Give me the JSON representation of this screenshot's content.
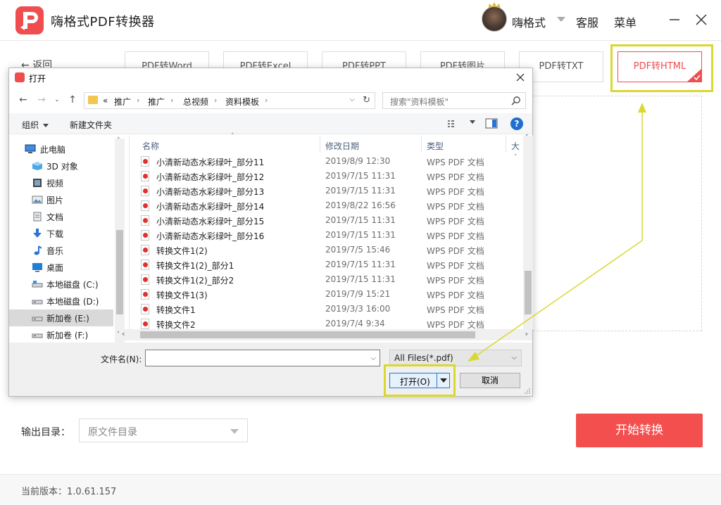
{
  "app": {
    "title": "嗨格式PDF转换器",
    "user_name": "嗨格式",
    "service": "客服",
    "menu": "菜单",
    "back": "返回",
    "version": "当前版本：1.0.61.157"
  },
  "tabs": [
    {
      "label": "PDF转Word"
    },
    {
      "label": "PDF转Excel"
    },
    {
      "label": "PDF转PPT"
    },
    {
      "label": "PDF转图片"
    },
    {
      "label": "PDF转TXT"
    },
    {
      "label": "PDF转HTML",
      "active": true
    }
  ],
  "output": {
    "label": "输出目录：",
    "value": "原文件目录"
  },
  "start_button": "开始转换",
  "colors": {
    "accent": "#f04e4e",
    "annotation": "#d9d830",
    "dialog_primary": "#2a74d8"
  },
  "dialog": {
    "title": "打开",
    "path": [
      "«",
      "推广",
      "推广",
      "总视频",
      "资料模板"
    ],
    "search_placeholder": "搜索\"资料模板\"",
    "organize": "组织",
    "new_folder": "新建文件夹",
    "help": "?",
    "nav_items": [
      {
        "label": "此电脑",
        "icon": "computer-icon"
      },
      {
        "label": "3D 对象",
        "icon": "cube-icon"
      },
      {
        "label": "视频",
        "icon": "video-icon"
      },
      {
        "label": "图片",
        "icon": "picture-icon"
      },
      {
        "label": "文档",
        "icon": "document-icon"
      },
      {
        "label": "下载",
        "icon": "download-icon"
      },
      {
        "label": "音乐",
        "icon": "music-icon"
      },
      {
        "label": "桌面",
        "icon": "desktop-icon"
      },
      {
        "label": "本地磁盘 (C:)",
        "icon": "drive-icon"
      },
      {
        "label": "本地磁盘 (D:)",
        "icon": "drive-icon"
      },
      {
        "label": "新加卷 (E:)",
        "icon": "drive-icon",
        "selected": true
      },
      {
        "label": "新加卷 (F:)",
        "icon": "drive-icon"
      }
    ],
    "columns": [
      "名称",
      "修改日期",
      "类型",
      "大小"
    ],
    "files": [
      {
        "name": "小清新动态水彩绿叶_部分11",
        "date": "2019/8/9 12:30",
        "type": "WPS PDF 文档"
      },
      {
        "name": "小清新动态水彩绿叶_部分12",
        "date": "2019/7/15 11:31",
        "type": "WPS PDF 文档"
      },
      {
        "name": "小清新动态水彩绿叶_部分13",
        "date": "2019/7/15 11:31",
        "type": "WPS PDF 文档"
      },
      {
        "name": "小清新动态水彩绿叶_部分14",
        "date": "2019/8/22 16:56",
        "type": "WPS PDF 文档"
      },
      {
        "name": "小清新动态水彩绿叶_部分15",
        "date": "2019/7/15 11:31",
        "type": "WPS PDF 文档"
      },
      {
        "name": "小清新动态水彩绿叶_部分16",
        "date": "2019/7/15 11:31",
        "type": "WPS PDF 文档"
      },
      {
        "name": "转换文件1(2)",
        "date": "2019/7/5 15:46",
        "type": "WPS PDF 文档"
      },
      {
        "name": "转换文件1(2)_部分1",
        "date": "2019/7/15 11:31",
        "type": "WPS PDF 文档"
      },
      {
        "name": "转换文件1(2)_部分2",
        "date": "2019/7/15 11:31",
        "type": "WPS PDF 文档"
      },
      {
        "name": "转换文件1(3)",
        "date": "2019/7/9 15:21",
        "type": "WPS PDF 文档"
      },
      {
        "name": "转换文件1",
        "date": "2019/3/3 16:00",
        "type": "WPS PDF 文档"
      },
      {
        "name": "转换文件2",
        "date": "2019/7/4 9:34",
        "type": "WPS PDF 文档"
      }
    ],
    "filename_label": "文件名(N):",
    "filename_value": "",
    "filter": "All Files(*.pdf)",
    "open_button": "打开(O)",
    "cancel_button": "取消"
  }
}
